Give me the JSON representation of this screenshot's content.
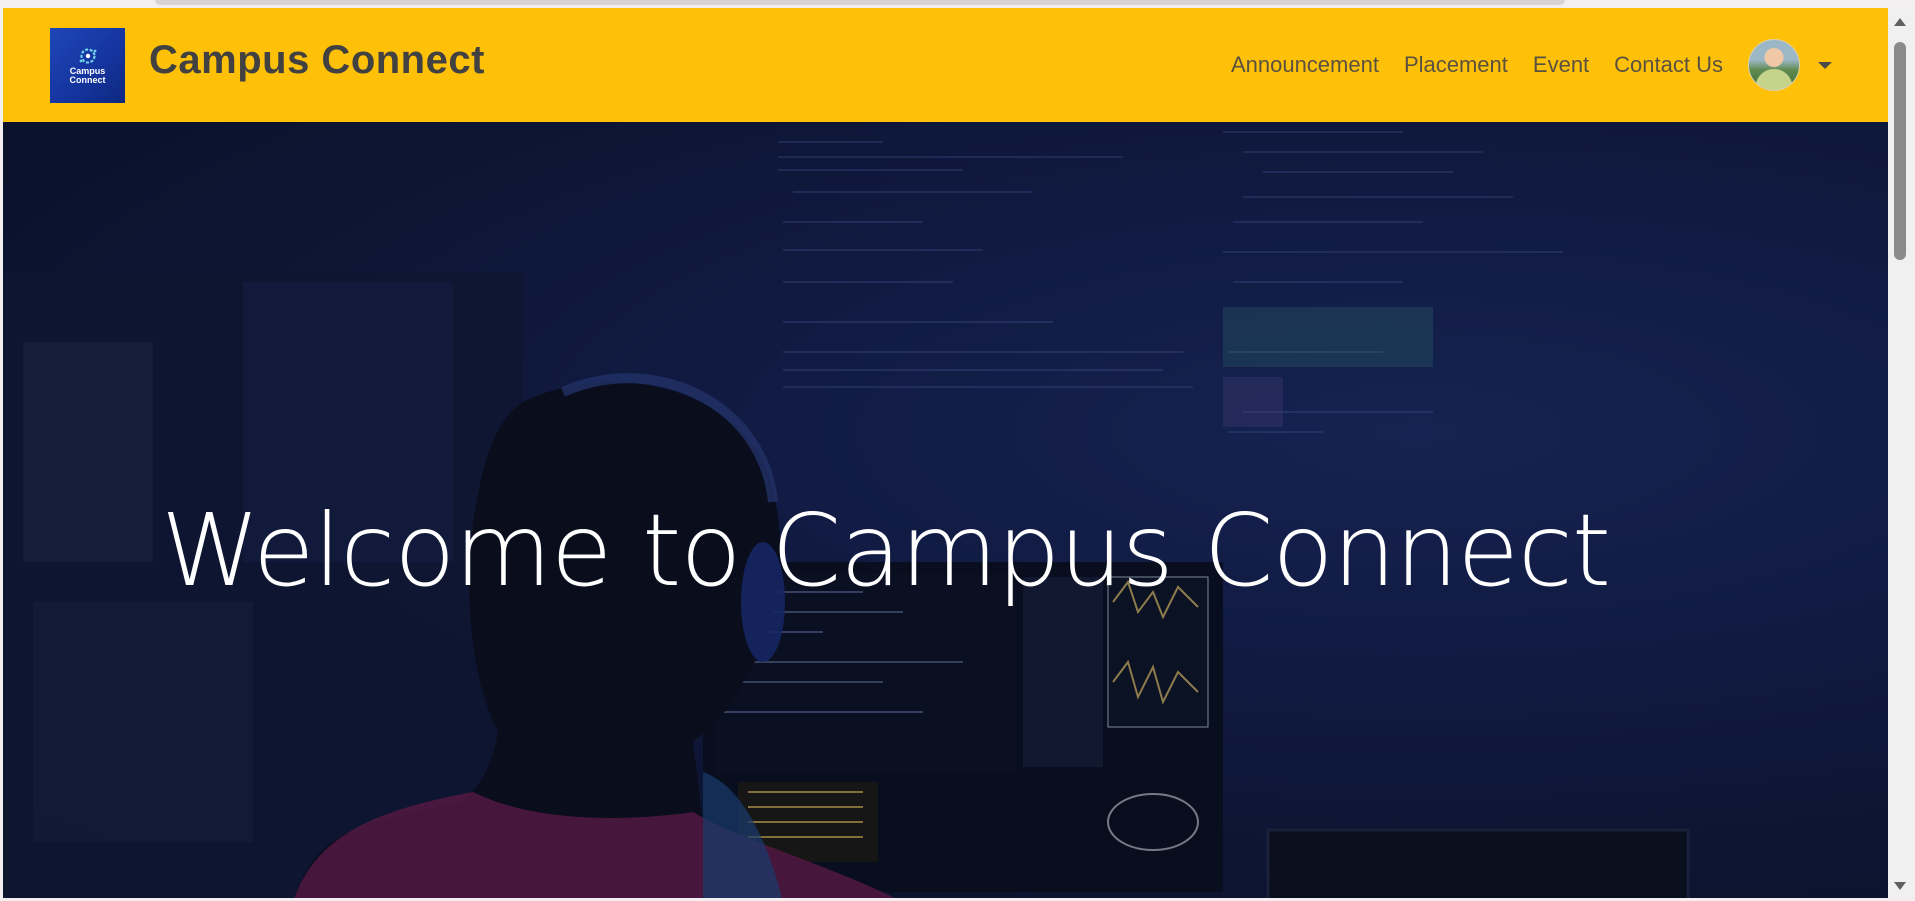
{
  "navbar": {
    "logo_text_line1": "Campus",
    "logo_text_line2": "Connect",
    "brand": "Campus Connect",
    "links": [
      {
        "label": "Announcement"
      },
      {
        "label": "Placement"
      },
      {
        "label": "Event"
      },
      {
        "label": "Contact Us"
      }
    ],
    "avatar_icon": "user-avatar",
    "dropdown_icon": "caret-down-icon"
  },
  "hero": {
    "title": "Welcome to Campus Connect",
    "background_icon": "developer-at-computer-image"
  },
  "colors": {
    "navbar": "#ffc107",
    "brand_text": "#414141",
    "nav_text": "#5a5140",
    "hero_text": "#ffffff",
    "logo_blue": "#1f46b8"
  }
}
